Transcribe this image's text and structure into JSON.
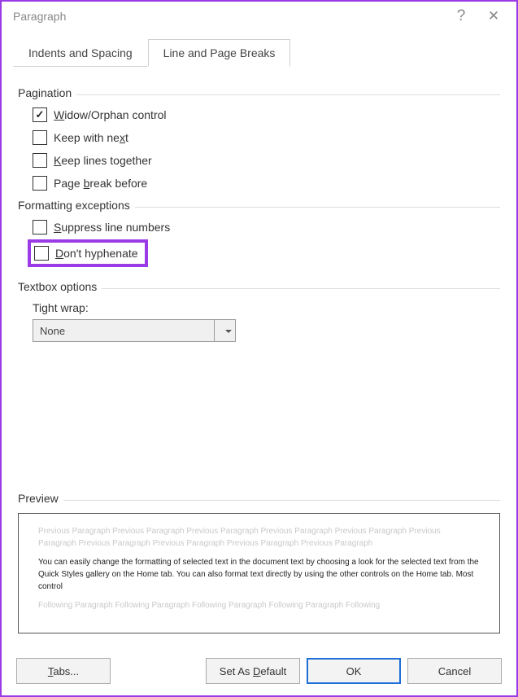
{
  "title": "Paragraph",
  "tabs": {
    "indents": "Indents and Spacing",
    "linebreaks": "Line and Page Breaks"
  },
  "sections": {
    "pagination": "Pagination",
    "formatting": "Formatting exceptions",
    "textbox": "Textbox options",
    "preview": "Preview"
  },
  "checkboxes": {
    "widow_pre": "W",
    "widow_rest": "idow/Orphan control",
    "keepnext_pre": "Keep with ne",
    "keepnext_u": "x",
    "keepnext_rest": "t",
    "keeplines_pre": "K",
    "keeplines_rest": "eep lines together",
    "pagebreak_pre": "Page ",
    "pagebreak_u": "b",
    "pagebreak_rest": "reak before",
    "suppress_pre": "S",
    "suppress_rest": "uppress line numbers",
    "donth_pre": "D",
    "donth_rest": "on't hyphenate"
  },
  "tightwrap": {
    "label": "Tight wrap:",
    "value": "None"
  },
  "preview": {
    "ghost1": "Previous Paragraph Previous Paragraph Previous Paragraph Previous Paragraph Previous Paragraph Previous Paragraph Previous Paragraph Previous Paragraph Previous Paragraph Previous Paragraph",
    "main": "You can easily change the formatting of selected text in the document text by choosing a look for the selected text from the Quick Styles gallery on the Home tab. You can also format text directly by using the other controls on the Home tab. Most control",
    "ghost2": "Following Paragraph Following Paragraph Following Paragraph Following Paragraph Following"
  },
  "buttons": {
    "tabs_u": "T",
    "tabs_rest": "abs...",
    "default_pre": "Set As ",
    "default_u": "D",
    "default_rest": "efault",
    "ok": "OK",
    "cancel": "Cancel"
  }
}
